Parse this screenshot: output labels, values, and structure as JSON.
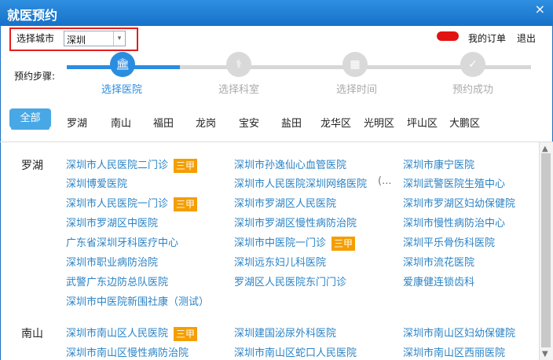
{
  "app": {
    "title": "就医预约",
    "close_icon": "close-icon"
  },
  "header": {
    "city_label": "选择城市",
    "city_value": "深圳",
    "my_orders": "我的订单",
    "logout": "退出"
  },
  "steps": {
    "label": "预约步骤:",
    "items": [
      "选择医院",
      "选择科室",
      "选择时间",
      "预约成功"
    ],
    "current": 1
  },
  "districts": [
    "全部",
    "罗湖",
    "南山",
    "福田",
    "龙岗",
    "宝安",
    "盐田",
    "龙华区",
    "光明区",
    "坪山区",
    "大鹏区"
  ],
  "luohu": {
    "name": "罗湖",
    "hospitals": [
      "深圳市人民医院二门诊",
      "深圳市孙逸仙心血管医院",
      "深圳市康宁医院",
      "深圳博爱医院",
      "深圳市人民医院深圳网络医院",
      "深圳武警医院生殖中心",
      "深圳市人民医院一门诊",
      "深圳市罗湖区人民医院",
      "深圳市罗湖区妇幼保健院",
      "深圳市罗湖区中医院",
      "深圳市罗湖区慢性病防治院",
      "深圳市慢性病防治中心",
      "广东省深圳牙科医疗中心",
      "深圳市中医院一门诊",
      "深圳平乐骨伤科医院",
      "深圳市职业病防治院",
      "深圳远东妇儿科医院",
      "深圳市流花医院",
      "武警广东边防总队医院",
      "罗湖区人民医院东门门诊",
      "爱康健连锁齿科",
      "深圳市中医院新围社康（测试）"
    ],
    "tags": [
      "三甲",
      "三甲",
      "三甲"
    ],
    "more": "(..."
  },
  "nanshan": {
    "name": "南山",
    "hospitals": [
      "深圳市南山区人民医院",
      "深圳建国泌尿外科医院",
      "深圳市南山区妇幼保健院",
      "深圳市南山区慢性病防治院",
      "深圳市南山区蛇口人民医院",
      "深圳市南山区西丽医院"
    ],
    "tags": [
      "三甲"
    ]
  }
}
